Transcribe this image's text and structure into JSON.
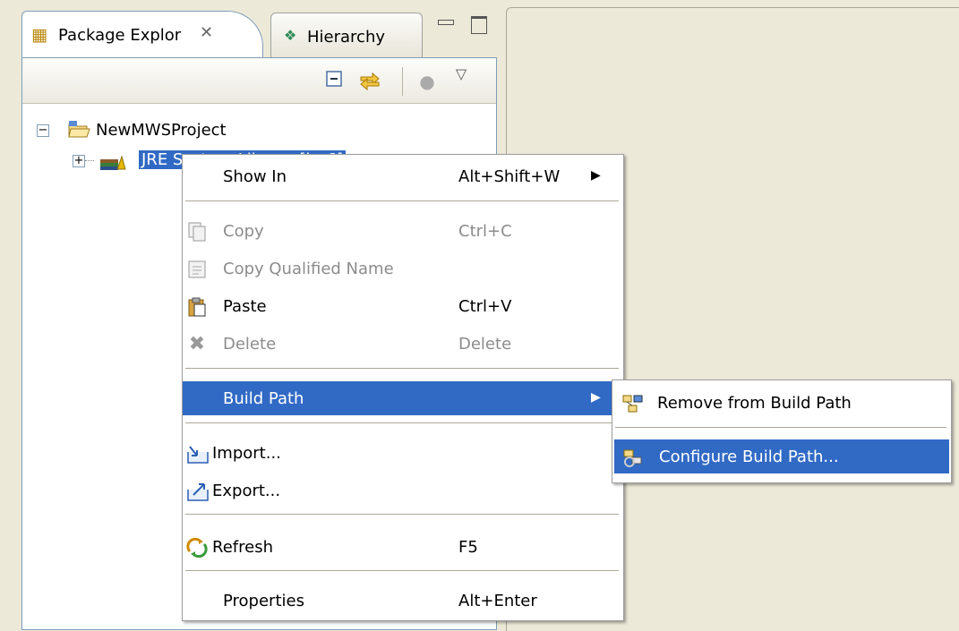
{
  "view": {
    "tabs": [
      {
        "label": "Package Explor",
        "icon": "package-explorer-icon",
        "active": true
      },
      {
        "label": "Hierarchy",
        "icon": "hierarchy-icon",
        "active": false
      }
    ],
    "toolbar": [
      {
        "name": "collapse-all-icon"
      },
      {
        "name": "link-with-editor-icon"
      },
      {
        "name": "filters-icon"
      },
      {
        "name": "view-menu-icon"
      }
    ]
  },
  "tree": {
    "project": {
      "label": "NewMWSProject",
      "expander": "−",
      "icon": "open-project-folder-icon"
    },
    "library": {
      "label": "JRE System Library [jre6]",
      "expander": "+",
      "icon": "library-icon",
      "selected": true
    }
  },
  "context_menu": {
    "show_in": {
      "label": "Show In",
      "accel": "Alt+Shift+W",
      "submenu": true
    },
    "copy": {
      "label": "Copy",
      "accel": "Ctrl+C",
      "enabled": false,
      "icon": "copy-icon"
    },
    "copy_qualified": {
      "label": "Copy Qualified Name",
      "enabled": false,
      "icon": "copy-qualified-name-icon"
    },
    "paste": {
      "label": "Paste",
      "accel": "Ctrl+V",
      "enabled": true,
      "icon": "paste-icon"
    },
    "delete": {
      "label": "Delete",
      "accel": "Delete",
      "enabled": false,
      "icon": "delete-icon"
    },
    "build_path": {
      "label": "Build Path",
      "submenu": true,
      "highlighted": true
    },
    "import": {
      "label": "Import...",
      "icon": "import-icon"
    },
    "export": {
      "label": "Export...",
      "icon": "export-icon"
    },
    "refresh": {
      "label": "Refresh",
      "accel": "F5",
      "icon": "refresh-icon"
    },
    "properties": {
      "label": "Properties",
      "accel": "Alt+Enter"
    }
  },
  "submenu": {
    "remove": {
      "label": "Remove from Build Path",
      "icon": "remove-from-build-path-icon"
    },
    "configure": {
      "label": "Configure Build Path...",
      "icon": "configure-build-path-icon",
      "highlighted": true
    }
  },
  "colors": {
    "selection": "#316ac5",
    "disabled_text": "#8c8c8c",
    "chrome": "#ece9d8"
  }
}
